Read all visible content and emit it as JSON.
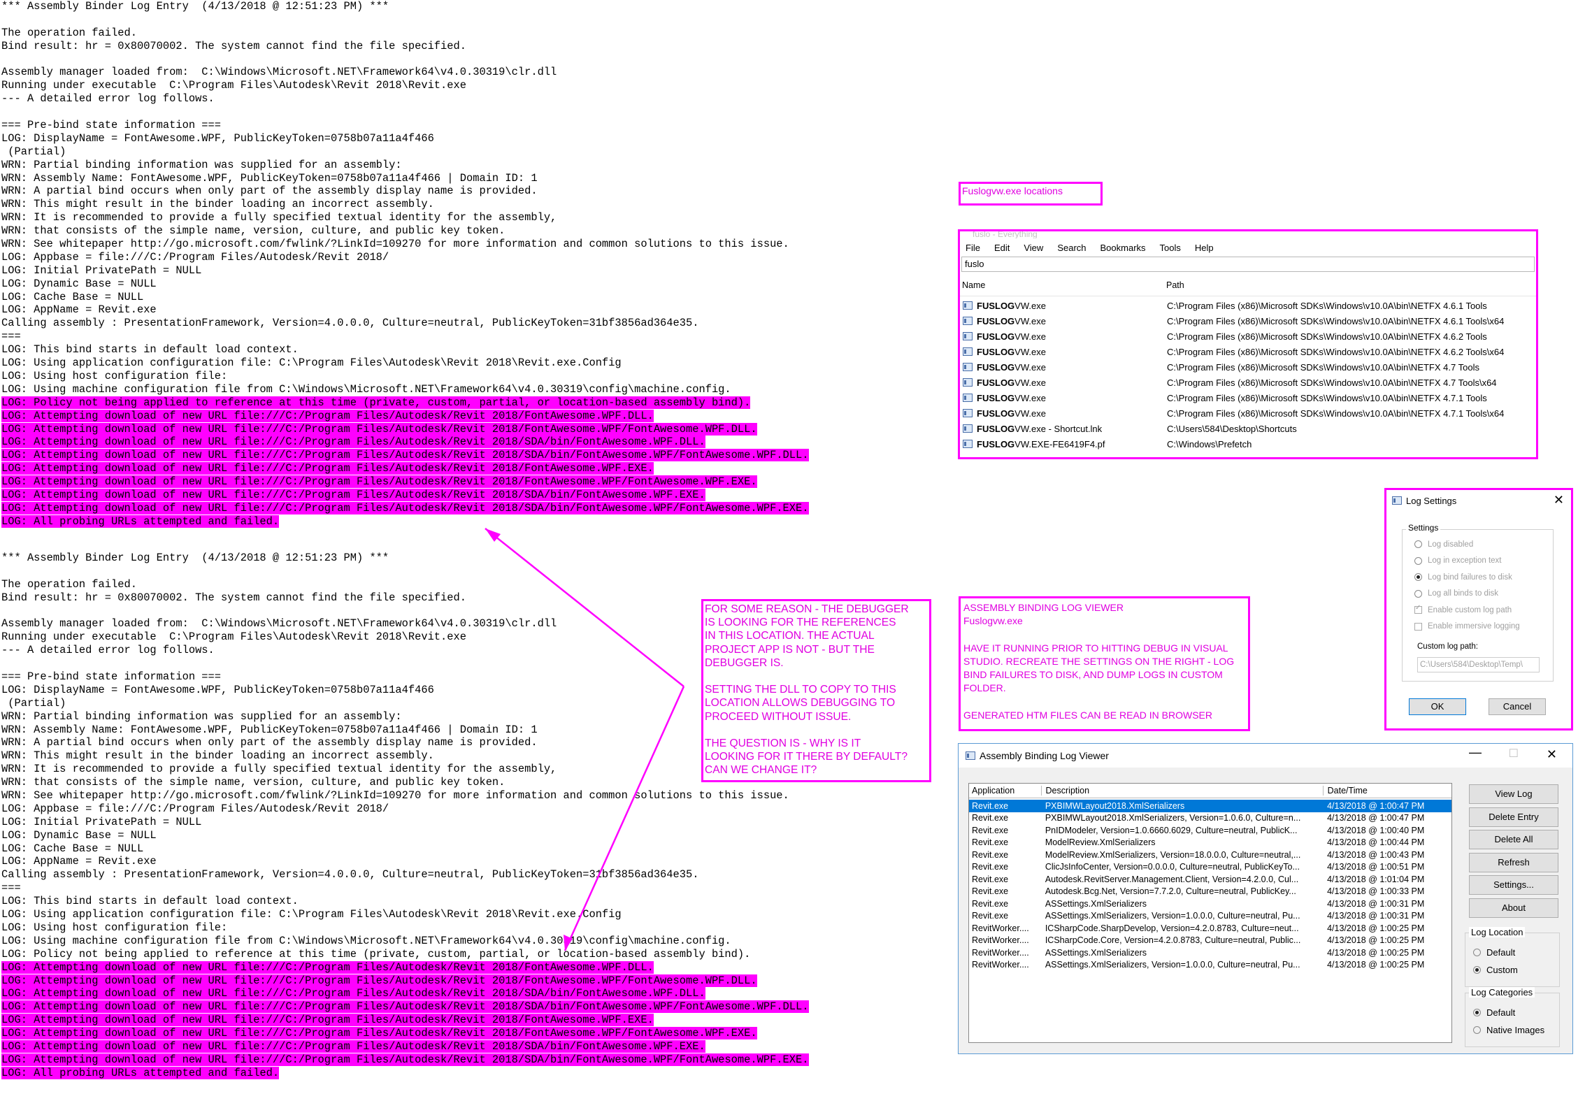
{
  "log_block_1": [
    {
      "text": "*** Assembly Binder Log Entry  (4/13/2018 @ 12:51:23 PM) ***",
      "hl": false
    },
    {
      "text": "",
      "hl": false
    },
    {
      "text": "The operation failed.",
      "hl": false
    },
    {
      "text": "Bind result: hr = 0x80070002. The system cannot find the file specified.",
      "hl": false
    },
    {
      "text": "",
      "hl": false
    },
    {
      "text": "Assembly manager loaded from:  C:\\Windows\\Microsoft.NET\\Framework64\\v4.0.30319\\clr.dll",
      "hl": false
    },
    {
      "text": "Running under executable  C:\\Program Files\\Autodesk\\Revit 2018\\Revit.exe",
      "hl": false
    },
    {
      "text": "--- A detailed error log follows.",
      "hl": false
    },
    {
      "text": "",
      "hl": false
    },
    {
      "text": "=== Pre-bind state information ===",
      "hl": false
    },
    {
      "text": "LOG: DisplayName = FontAwesome.WPF, PublicKeyToken=0758b07a11a4f466",
      "hl": false
    },
    {
      "text": " (Partial)",
      "hl": false
    },
    {
      "text": "WRN: Partial binding information was supplied for an assembly:",
      "hl": false
    },
    {
      "text": "WRN: Assembly Name: FontAwesome.WPF, PublicKeyToken=0758b07a11a4f466 | Domain ID: 1",
      "hl": false
    },
    {
      "text": "WRN: A partial bind occurs when only part of the assembly display name is provided.",
      "hl": false
    },
    {
      "text": "WRN: This might result in the binder loading an incorrect assembly.",
      "hl": false
    },
    {
      "text": "WRN: It is recommended to provide a fully specified textual identity for the assembly,",
      "hl": false
    },
    {
      "text": "WRN: that consists of the simple name, version, culture, and public key token.",
      "hl": false
    },
    {
      "text": "WRN: See whitepaper http://go.microsoft.com/fwlink/?LinkId=109270 for more information and common solutions to this issue.",
      "hl": false
    },
    {
      "text": "LOG: Appbase = file:///C:/Program Files/Autodesk/Revit 2018/",
      "hl": false
    },
    {
      "text": "LOG: Initial PrivatePath = NULL",
      "hl": false
    },
    {
      "text": "LOG: Dynamic Base = NULL",
      "hl": false
    },
    {
      "text": "LOG: Cache Base = NULL",
      "hl": false
    },
    {
      "text": "LOG: AppName = Revit.exe",
      "hl": false
    },
    {
      "text": "Calling assembly : PresentationFramework, Version=4.0.0.0, Culture=neutral, PublicKeyToken=31bf3856ad364e35.",
      "hl": false
    },
    {
      "text": "===",
      "hl": false
    },
    {
      "text": "LOG: This bind starts in default load context.",
      "hl": false
    },
    {
      "text": "LOG: Using application configuration file: C:\\Program Files\\Autodesk\\Revit 2018\\Revit.exe.Config",
      "hl": false
    },
    {
      "text": "LOG: Using host configuration file:",
      "hl": false
    },
    {
      "text": "LOG: Using machine configuration file from C:\\Windows\\Microsoft.NET\\Framework64\\v4.0.30319\\config\\machine.config.",
      "hl": false
    },
    {
      "text": "LOG: Policy not being applied to reference at this time (private, custom, partial, or location-based assembly bind).",
      "hl": true
    },
    {
      "text": "LOG: Attempting download of new URL file:///C:/Program Files/Autodesk/Revit 2018/FontAwesome.WPF.DLL.",
      "hl": true
    },
    {
      "text": "LOG: Attempting download of new URL file:///C:/Program Files/Autodesk/Revit 2018/FontAwesome.WPF/FontAwesome.WPF.DLL.",
      "hl": true
    },
    {
      "text": "LOG: Attempting download of new URL file:///C:/Program Files/Autodesk/Revit 2018/SDA/bin/FontAwesome.WPF.DLL.",
      "hl": true
    },
    {
      "text": "LOG: Attempting download of new URL file:///C:/Program Files/Autodesk/Revit 2018/SDA/bin/FontAwesome.WPF/FontAwesome.WPF.DLL.",
      "hl": true
    },
    {
      "text": "LOG: Attempting download of new URL file:///C:/Program Files/Autodesk/Revit 2018/FontAwesome.WPF.EXE.",
      "hl": true
    },
    {
      "text": "LOG: Attempting download of new URL file:///C:/Program Files/Autodesk/Revit 2018/FontAwesome.WPF/FontAwesome.WPF.EXE.",
      "hl": true
    },
    {
      "text": "LOG: Attempting download of new URL file:///C:/Program Files/Autodesk/Revit 2018/SDA/bin/FontAwesome.WPF.EXE.",
      "hl": true
    },
    {
      "text": "LOG: Attempting download of new URL file:///C:/Program Files/Autodesk/Revit 2018/SDA/bin/FontAwesome.WPF/FontAwesome.WPF.EXE.",
      "hl": true
    },
    {
      "text": "LOG: All probing URLs attempted and failed.",
      "hl": true
    }
  ],
  "log_block_2": [
    {
      "text": "*** Assembly Binder Log Entry  (4/13/2018 @ 12:51:23 PM) ***",
      "hl": false
    },
    {
      "text": "",
      "hl": false
    },
    {
      "text": "The operation failed.",
      "hl": false
    },
    {
      "text": "Bind result: hr = 0x80070002. The system cannot find the file specified.",
      "hl": false
    },
    {
      "text": "",
      "hl": false
    },
    {
      "text": "Assembly manager loaded from:  C:\\Windows\\Microsoft.NET\\Framework64\\v4.0.30319\\clr.dll",
      "hl": false
    },
    {
      "text": "Running under executable  C:\\Program Files\\Autodesk\\Revit 2018\\Revit.exe",
      "hl": false
    },
    {
      "text": "--- A detailed error log follows.",
      "hl": false
    },
    {
      "text": "",
      "hl": false
    },
    {
      "text": "=== Pre-bind state information ===",
      "hl": false
    },
    {
      "text": "LOG: DisplayName = FontAwesome.WPF, PublicKeyToken=0758b07a11a4f466",
      "hl": false
    },
    {
      "text": " (Partial)",
      "hl": false
    },
    {
      "text": "WRN: Partial binding information was supplied for an assembly:",
      "hl": false
    },
    {
      "text": "WRN: Assembly Name: FontAwesome.WPF, PublicKeyToken=0758b07a11a4f466 | Domain ID: 1",
      "hl": false
    },
    {
      "text": "WRN: A partial bind occurs when only part of the assembly display name is provided.",
      "hl": false
    },
    {
      "text": "WRN: This might result in the binder loading an incorrect assembly.",
      "hl": false
    },
    {
      "text": "WRN: It is recommended to provide a fully specified textual identity for the assembly,",
      "hl": false
    },
    {
      "text": "WRN: that consists of the simple name, version, culture, and public key token.",
      "hl": false
    },
    {
      "text": "WRN: See whitepaper http://go.microsoft.com/fwlink/?LinkId=109270 for more information and common solutions to this issue.",
      "hl": false
    },
    {
      "text": "LOG: Appbase = file:///C:/Program Files/Autodesk/Revit 2018/",
      "hl": false
    },
    {
      "text": "LOG: Initial PrivatePath = NULL",
      "hl": false
    },
    {
      "text": "LOG: Dynamic Base = NULL",
      "hl": false
    },
    {
      "text": "LOG: Cache Base = NULL",
      "hl": false
    },
    {
      "text": "LOG: AppName = Revit.exe",
      "hl": false
    },
    {
      "text": "Calling assembly : PresentationFramework, Version=4.0.0.0, Culture=neutral, PublicKeyToken=31bf3856ad364e35.",
      "hl": false
    },
    {
      "text": "===",
      "hl": false
    },
    {
      "text": "LOG: This bind starts in default load context.",
      "hl": false
    },
    {
      "text": "LOG: Using application configuration file: C:\\Program Files\\Autodesk\\Revit 2018\\Revit.exe.Config",
      "hl": false
    },
    {
      "text": "LOG: Using host configuration file:",
      "hl": false
    },
    {
      "text": "LOG: Using machine configuration file from C:\\Windows\\Microsoft.NET\\Framework64\\v4.0.30319\\config\\machine.config.",
      "hl": false
    },
    {
      "text": "LOG: Policy not being applied to reference at this time (private, custom, partial, or location-based assembly bind).",
      "hl": false
    },
    {
      "text": "LOG: Attempting download of new URL file:///C:/Program Files/Autodesk/Revit 2018/FontAwesome.WPF.DLL.",
      "hl": true
    },
    {
      "text": "LOG: Attempting download of new URL file:///C:/Program Files/Autodesk/Revit 2018/FontAwesome.WPF/FontAwesome.WPF.DLL.",
      "hl": true
    },
    {
      "text": "LOG: Attempting download of new URL file:///C:/Program Files/Autodesk/Revit 2018/SDA/bin/FontAwesome.WPF.DLL.",
      "hl": true
    },
    {
      "text": "LOG: Attempting download of new URL file:///C:/Program Files/Autodesk/Revit 2018/SDA/bin/FontAwesome.WPF/FontAwesome.WPF.DLL.",
      "hl": true
    },
    {
      "text": "LOG: Attempting download of new URL file:///C:/Program Files/Autodesk/Revit 2018/FontAwesome.WPF.EXE.",
      "hl": true
    },
    {
      "text": "LOG: Attempting download of new URL file:///C:/Program Files/Autodesk/Revit 2018/FontAwesome.WPF/FontAwesome.WPF.EXE.",
      "hl": true
    },
    {
      "text": "LOG: Attempting download of new URL file:///C:/Program Files/Autodesk/Revit 2018/SDA/bin/FontAwesome.WPF.EXE.",
      "hl": true
    },
    {
      "text": "LOG: Attempting download of new URL file:///C:/Program Files/Autodesk/Revit 2018/SDA/bin/FontAwesome.WPF/FontAwesome.WPF.EXE.",
      "hl": true
    },
    {
      "text": "LOG: All probing URLs attempted and failed.",
      "hl": true
    }
  ],
  "annotation": {
    "lines": [
      "FOR SOME REASON - THE DEBUGGER",
      "IS LOOKING FOR THE REFERENCES",
      "IN THIS LOCATION. THE ACTUAL",
      "PROJECT APP IS NOT - BUT THE",
      "DEBUGGER IS.",
      "",
      "SETTING THE DLL TO COPY TO THIS",
      "LOCATION ALLOWS DEBUGGING TO",
      "PROCEED WITHOUT ISSUE.",
      "",
      "THE QUESTION IS - WHY IS IT",
      "LOOKING FOR IT THERE BY DEFAULT?",
      "CAN WE CHANGE IT?"
    ]
  },
  "fuslogvw_label": "Fuslogvw.exe locations",
  "everything": {
    "title": "fuslo - Everything",
    "menu": [
      "File",
      "Edit",
      "View",
      "Search",
      "Bookmarks",
      "Tools",
      "Help"
    ],
    "search_value": "fuslo",
    "col_name": "Name",
    "col_path": "Path",
    "rows": [
      {
        "name_bold": "FUSLOG",
        "name_rest": "VW.exe",
        "path": "C:\\Program Files (x86)\\Microsoft SDKs\\Windows\\v10.0A\\bin\\NETFX 4.6.1 Tools"
      },
      {
        "name_bold": "FUSLOG",
        "name_rest": "VW.exe",
        "path": "C:\\Program Files (x86)\\Microsoft SDKs\\Windows\\v10.0A\\bin\\NETFX 4.6.1 Tools\\x64"
      },
      {
        "name_bold": "FUSLOG",
        "name_rest": "VW.exe",
        "path": "C:\\Program Files (x86)\\Microsoft SDKs\\Windows\\v10.0A\\bin\\NETFX 4.6.2 Tools"
      },
      {
        "name_bold": "FUSLOG",
        "name_rest": "VW.exe",
        "path": "C:\\Program Files (x86)\\Microsoft SDKs\\Windows\\v10.0A\\bin\\NETFX 4.6.2 Tools\\x64"
      },
      {
        "name_bold": "FUSLOG",
        "name_rest": "VW.exe",
        "path": "C:\\Program Files (x86)\\Microsoft SDKs\\Windows\\v10.0A\\bin\\NETFX 4.7 Tools"
      },
      {
        "name_bold": "FUSLOG",
        "name_rest": "VW.exe",
        "path": "C:\\Program Files (x86)\\Microsoft SDKs\\Windows\\v10.0A\\bin\\NETFX 4.7 Tools\\x64"
      },
      {
        "name_bold": "FUSLOG",
        "name_rest": "VW.exe",
        "path": "C:\\Program Files (x86)\\Microsoft SDKs\\Windows\\v10.0A\\bin\\NETFX 4.7.1 Tools"
      },
      {
        "name_bold": "FUSLOG",
        "name_rest": "VW.exe",
        "path": "C:\\Program Files (x86)\\Microsoft SDKs\\Windows\\v10.0A\\bin\\NETFX 4.7.1 Tools\\x64"
      },
      {
        "name_bold": "FUSLOG",
        "name_rest": "VW.exe - Shortcut.lnk",
        "path": "C:\\Users\\584\\Desktop\\Shortcuts"
      },
      {
        "name_bold": "FUSLOG",
        "name_rest": "VW.EXE-FE6419F4.pf",
        "path": "C:\\Windows\\Prefetch"
      }
    ]
  },
  "log_settings": {
    "title": "Log Settings",
    "group": "Settings",
    "options": [
      {
        "label": "Log disabled",
        "on": false
      },
      {
        "label": "Log in exception text",
        "on": false
      },
      {
        "label": "Log bind failures to disk",
        "on": true
      },
      {
        "label": "Log all binds to disk",
        "on": false
      }
    ],
    "checks": [
      {
        "label": "Enable custom log path",
        "on": true
      },
      {
        "label": "Enable immersive logging",
        "on": false
      }
    ],
    "custom_path_label": "Custom log path:",
    "custom_path_value": "C:\\Users\\584\\Desktop\\Temp\\",
    "ok": "OK",
    "cancel": "Cancel"
  },
  "binding_note": {
    "lines": [
      "ASSEMBLY BINDING LOG VIEWER",
      "Fuslogvw.exe",
      "",
      "HAVE IT RUNNING PRIOR TO HITTING DEBUG IN VISUAL",
      "STUDIO. RECREATE THE SETTINGS ON THE RIGHT - LOG",
      "BIND FAILURES TO DISK, AND DUMP LOGS IN CUSTOM",
      "FOLDER.",
      "",
      "GENERATED HTM FILES CAN BE READ IN BROWSER"
    ]
  },
  "abl_viewer": {
    "title": "Assembly Binding Log Viewer",
    "col_app": "Application",
    "col_desc": "Description",
    "col_date": "Date/Time",
    "rows": [
      {
        "app": "Revit.exe",
        "desc": "PXBIMWLayout2018.XmlSerializers",
        "date": "4/13/2018 @ 1:00:47 PM"
      },
      {
        "app": "Revit.exe",
        "desc": "PXBIMWLayout2018.XmlSerializers, Version=1.0.6.0, Culture=n...",
        "date": "4/13/2018 @ 1:00:47 PM"
      },
      {
        "app": "Revit.exe",
        "desc": "PnIDModeler, Version=1.0.6660.6029, Culture=neutral, PublicK...",
        "date": "4/13/2018 @ 1:00:40 PM"
      },
      {
        "app": "Revit.exe",
        "desc": "ModelReview.XmlSerializers",
        "date": "4/13/2018 @ 1:00:44 PM"
      },
      {
        "app": "Revit.exe",
        "desc": "ModelReview.XmlSerializers, Version=18.0.0.0, Culture=neutral,...",
        "date": "4/13/2018 @ 1:00:43 PM"
      },
      {
        "app": "Revit.exe",
        "desc": "ClicJsInfoCenter, Version=0.0.0.0, Culture=neutral, PublicKeyTo...",
        "date": "4/13/2018 @ 1:00:51 PM"
      },
      {
        "app": "Revit.exe",
        "desc": "Autodesk.RevitServer.Management.Client, Version=4.2.0.0, Cul...",
        "date": "4/13/2018 @ 1:01:04 PM"
      },
      {
        "app": "Revit.exe",
        "desc": "Autodesk.Bcg.Net, Version=7.7.2.0, Culture=neutral, PublicKey...",
        "date": "4/13/2018 @ 1:00:33 PM"
      },
      {
        "app": "Revit.exe",
        "desc": "ASSettings.XmlSerializers",
        "date": "4/13/2018 @ 1:00:31 PM"
      },
      {
        "app": "Revit.exe",
        "desc": "ASSettings.XmlSerializers, Version=1.0.0.0, Culture=neutral, Pu...",
        "date": "4/13/2018 @ 1:00:31 PM"
      },
      {
        "app": "RevitWorker....",
        "desc": "ICSharpCode.SharpDevelop, Version=4.2.0.8783, Culture=neut...",
        "date": "4/13/2018 @ 1:00:25 PM"
      },
      {
        "app": "RevitWorker....",
        "desc": "ICSharpCode.Core, Version=4.2.0.8783, Culture=neutral, Public...",
        "date": "4/13/2018 @ 1:00:25 PM"
      },
      {
        "app": "RevitWorker....",
        "desc": "ASSettings.XmlSerializers",
        "date": "4/13/2018 @ 1:00:25 PM"
      },
      {
        "app": "RevitWorker....",
        "desc": "ASSettings.XmlSerializers, Version=1.0.0.0, Culture=neutral, Pu...",
        "date": "4/13/2018 @ 1:00:25 PM"
      }
    ],
    "buttons": [
      "View Log",
      "Delete Entry",
      "Delete All",
      "Refresh",
      "Settings...",
      "About"
    ],
    "log_location_label": "Log Location",
    "log_location": [
      {
        "label": "Default",
        "on": false
      },
      {
        "label": "Custom",
        "on": true
      }
    ],
    "log_categories_label": "Log Categories",
    "log_categories": [
      {
        "label": "Default",
        "on": true
      },
      {
        "label": "Native Images",
        "on": false
      }
    ]
  }
}
